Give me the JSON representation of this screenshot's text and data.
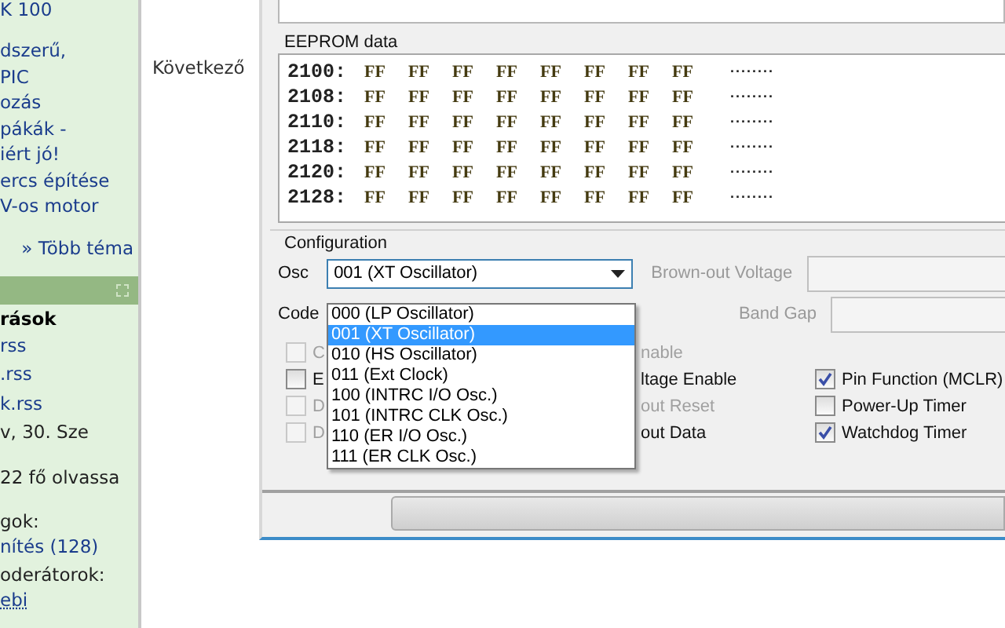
{
  "sidebar": {
    "top_items": [
      {
        "kind": "link",
        "text": "K 100"
      },
      {
        "kind": "gap"
      },
      {
        "kind": "link",
        "text": "dszerű,"
      },
      {
        "kind": "link",
        "text": "PIC"
      },
      {
        "kind": "link",
        "text": "ozás"
      },
      {
        "kind": "link",
        "text": "pákák -"
      },
      {
        "kind": "link",
        "text": "iért jó!"
      },
      {
        "kind": "link",
        "text": "ercs építése"
      },
      {
        "kind": "link",
        "text": "V-os motor"
      },
      {
        "kind": "gap"
      },
      {
        "kind": "more",
        "text": "» Több téma"
      }
    ],
    "bottom_items": [
      {
        "kind": "bold",
        "text": "rások"
      },
      {
        "kind": "link",
        "text": "rss"
      },
      {
        "kind": "link",
        "text": ".rss"
      },
      {
        "kind": "link",
        "text": "k.rss"
      },
      {
        "kind": "text",
        "text": "v, 30. Sze"
      },
      {
        "kind": "gap"
      },
      {
        "kind": "text",
        "text": "22 fő olvassa"
      },
      {
        "kind": "gap"
      },
      {
        "kind": "text",
        "text": "gok:"
      },
      {
        "kind": "link",
        "text": "nítés (128)"
      },
      {
        "kind": "text",
        "text": "oderátorok:"
      },
      {
        "kind": "user",
        "text": "ebi"
      }
    ]
  },
  "next_label": "Következő",
  "eeprom": {
    "title": "EEPROM data",
    "rows": [
      {
        "address": "2100:",
        "bytes": [
          "FF",
          "FF",
          "FF",
          "FF",
          "FF",
          "FF",
          "FF",
          "FF"
        ],
        "ascii": "........"
      },
      {
        "address": "2108:",
        "bytes": [
          "FF",
          "FF",
          "FF",
          "FF",
          "FF",
          "FF",
          "FF",
          "FF"
        ],
        "ascii": "........"
      },
      {
        "address": "2110:",
        "bytes": [
          "FF",
          "FF",
          "FF",
          "FF",
          "FF",
          "FF",
          "FF",
          "FF"
        ],
        "ascii": "........"
      },
      {
        "address": "2118:",
        "bytes": [
          "FF",
          "FF",
          "FF",
          "FF",
          "FF",
          "FF",
          "FF",
          "FF"
        ],
        "ascii": "........"
      },
      {
        "address": "2120:",
        "bytes": [
          "FF",
          "FF",
          "FF",
          "FF",
          "FF",
          "FF",
          "FF",
          "FF"
        ],
        "ascii": "........"
      },
      {
        "address": "2128:",
        "bytes": [
          "FF",
          "FF",
          "FF",
          "FF",
          "FF",
          "FF",
          "FF",
          "FF"
        ],
        "ascii": "........"
      }
    ]
  },
  "configuration": {
    "title": "Configuration",
    "osc": {
      "label": "Osc",
      "value": "001 (XT Oscillator)",
      "expanded": true,
      "options": [
        {
          "text": "000 (LP Oscillator)",
          "selected": false
        },
        {
          "text": "001 (XT Oscillator)",
          "selected": true
        },
        {
          "text": "010 (HS Oscillator)",
          "selected": false
        },
        {
          "text": "011 (Ext Clock)",
          "selected": false
        },
        {
          "text": "100 (INTRC I/O Osc.)",
          "selected": false
        },
        {
          "text": "101 (INTRC CLK Osc.)",
          "selected": false
        },
        {
          "text": "110 (ER I/O Osc.)",
          "selected": false
        },
        {
          "text": "111 (ER CLK Osc.)",
          "selected": false
        }
      ]
    },
    "code_label": "Code",
    "brownout": {
      "label": "Brown-out Voltage",
      "disabled": true
    },
    "bandgap": {
      "label": "Band Gap",
      "disabled": true
    },
    "left_checkboxes": [
      {
        "label": "C",
        "checked": false,
        "disabled": true
      },
      {
        "label": "E",
        "checked": false,
        "disabled": false
      },
      {
        "label": "D",
        "checked": false,
        "disabled": true
      },
      {
        "label": "D",
        "checked": false,
        "disabled": true
      }
    ],
    "middle_labels": [
      {
        "label": "nable",
        "disabled": true
      },
      {
        "label": "ltage Enable",
        "disabled": false
      },
      {
        "label": "out Reset",
        "disabled": true
      },
      {
        "label": "out Data",
        "disabled": false
      }
    ],
    "right_checkboxes": [
      {
        "label": "Pin Function (MCLR)",
        "checked": true,
        "disabled": false
      },
      {
        "label": "Power-Up Timer",
        "checked": false,
        "disabled": false
      },
      {
        "label": "Watchdog Timer",
        "checked": true,
        "disabled": false
      }
    ]
  }
}
